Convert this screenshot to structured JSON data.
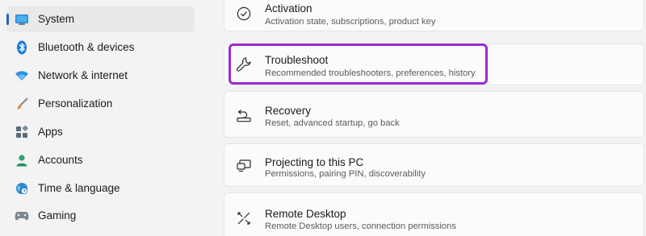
{
  "sidebar": {
    "items": [
      {
        "label": "System",
        "icon": "monitor-icon",
        "selected": true
      },
      {
        "label": "Bluetooth & devices",
        "icon": "bluetooth-icon"
      },
      {
        "label": "Network & internet",
        "icon": "wifi-icon"
      },
      {
        "label": "Personalization",
        "icon": "paintbrush-icon"
      },
      {
        "label": "Apps",
        "icon": "apps-icon"
      },
      {
        "label": "Accounts",
        "icon": "person-icon"
      },
      {
        "label": "Time & language",
        "icon": "globe-clock-icon"
      },
      {
        "label": "Gaming",
        "icon": "gamepad-icon"
      }
    ]
  },
  "main": {
    "cards": [
      {
        "title": "Activation",
        "subtitle": "Activation state, subscriptions, product key",
        "icon": "check-circle-icon"
      },
      {
        "title": "Troubleshoot",
        "subtitle": "Recommended troubleshooters, preferences, history",
        "icon": "wrench-icon"
      },
      {
        "title": "Recovery",
        "subtitle": "Reset, advanced startup, go back",
        "icon": "recovery-icon"
      },
      {
        "title": "Projecting to this PC",
        "subtitle": "Permissions, pairing PIN, discoverability",
        "icon": "projecting-icon"
      },
      {
        "title": "Remote Desktop",
        "subtitle": "Remote Desktop users, connection permissions",
        "icon": "remote-desktop-icon"
      }
    ]
  },
  "colors": {
    "accent": "#2a63b8",
    "highlight": "#9b2bd0"
  }
}
